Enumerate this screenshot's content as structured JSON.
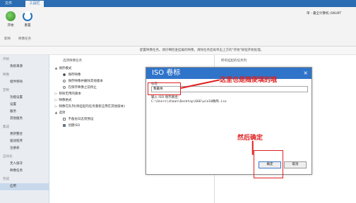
{
  "ribbon_tabs": [
    "文件",
    "工具栏"
  ],
  "ribbon_buttons": [
    {
      "label": "开始",
      "icon": "start-icon"
    },
    {
      "label": "重置",
      "icon": "refresh-icon"
    }
  ],
  "ribbon_groups": [
    "影映",
    "映像任务"
  ],
  "info_text": "配置映像任务。请仔细检查挂载的映像，清除任务后再单击上方的\"开始\"按钮开始处理。",
  "nav": [
    {
      "label": "开始",
      "section": true
    },
    {
      "label": "系统来源",
      "section": false
    },
    {
      "label": "映像",
      "section": true
    },
    {
      "label": "组件移除",
      "section": false
    },
    {
      "label": "定制",
      "section": true
    },
    {
      "label": "功能设置",
      "section": false
    },
    {
      "label": "设置",
      "section": false
    },
    {
      "label": "服务",
      "section": false
    },
    {
      "label": "其他服务",
      "section": false
    },
    {
      "label": "集成",
      "section": true
    },
    {
      "label": "更新整合",
      "section": false
    },
    {
      "label": "驱动程序",
      "section": false
    },
    {
      "label": "注册表",
      "section": false
    },
    {
      "label": "自动化",
      "section": true
    },
    {
      "label": "无人值守",
      "section": false
    },
    {
      "label": "映像任务",
      "section": false
    },
    {
      "label": "完成",
      "section": true
    },
    {
      "label": "应用",
      "section": false,
      "selected": true
    }
  ],
  "columns": {
    "left": "选项映像任务",
    "right": "所有挂起的任务列"
  },
  "options": [
    {
      "marker": "▲",
      "type": "none",
      "label": "保存模式"
    },
    {
      "marker": "",
      "type": "radio",
      "checked": true,
      "label": "保存映像"
    },
    {
      "marker": "",
      "type": "radio",
      "checked": false,
      "label": "保存映像并删除其他版本"
    },
    {
      "marker": "",
      "type": "radio",
      "checked": false,
      "label": "在保存映像之前停止"
    },
    {
      "marker": "▷",
      "type": "none",
      "label": "移除无用的版本"
    },
    {
      "marker": "▷",
      "type": "none",
      "label": "映像格式"
    },
    {
      "marker": "▷",
      "type": "none",
      "label": "映像在队列(将挂起的任务重新应用在其他版本)"
    },
    {
      "marker": "▲",
      "type": "none",
      "label": "选项"
    },
    {
      "marker": "",
      "type": "checkbox",
      "checked": false,
      "label": "不备份日志到预设"
    },
    {
      "marker": "",
      "type": "checkbox",
      "checked": true,
      "label": "创建ISO"
    }
  ],
  "right_text": "单 - 裏全计算机 (SKU9T",
  "dialog": {
    "title": "ISO 卷标",
    "close": "×",
    "label": "标签",
    "input_value": "我最帅",
    "path_label": "输入 ISO 保存路径:",
    "path_value": "C:\\Users\\zhaan\\Desktop\\666\\win10精简.iso",
    "ok": "确定",
    "cancel": "取消"
  },
  "annotations": {
    "input_note": "这里也是随便填的哦",
    "ok_note": "然后确定"
  },
  "colors": {
    "accent": "#2f74c9",
    "annotation": "#e02020"
  }
}
